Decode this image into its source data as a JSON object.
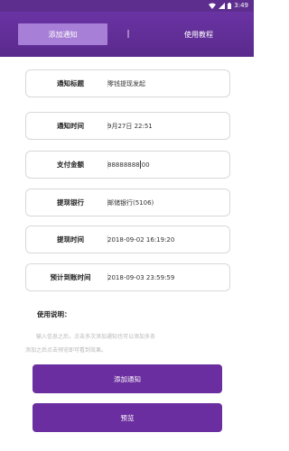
{
  "status_bar": {
    "time": "3:49"
  },
  "header": {
    "tab_add": "添加通知",
    "separator": "|",
    "tab_guide": "使用教程"
  },
  "form": {
    "rows": [
      {
        "label": "通知标题",
        "value": "零钱提现发起"
      },
      {
        "label": "通知时间",
        "value": "9月27日 22:51"
      },
      {
        "label": "支付金额",
        "value_before_caret": "88888888",
        "value_after_caret": "00"
      },
      {
        "label": "提现银行",
        "value": "邮储银行(5106)"
      },
      {
        "label": "提现时间",
        "value": "2018-09-02 16:19:20"
      },
      {
        "label": "预计到账时间",
        "value": "2018-09-03 23:59:59"
      }
    ]
  },
  "usage": {
    "title": "使用说明：",
    "line1": "输入信息之后，点击多次添加通知也可以添加多条",
    "line2": "添加之后点击预览即可看到效果。"
  },
  "buttons": {
    "add": "添加通知",
    "preview": "预览"
  },
  "colors": {
    "header": "#5e2e8f",
    "tab_active": "#a77fd6",
    "button": "#6b2ea0"
  }
}
